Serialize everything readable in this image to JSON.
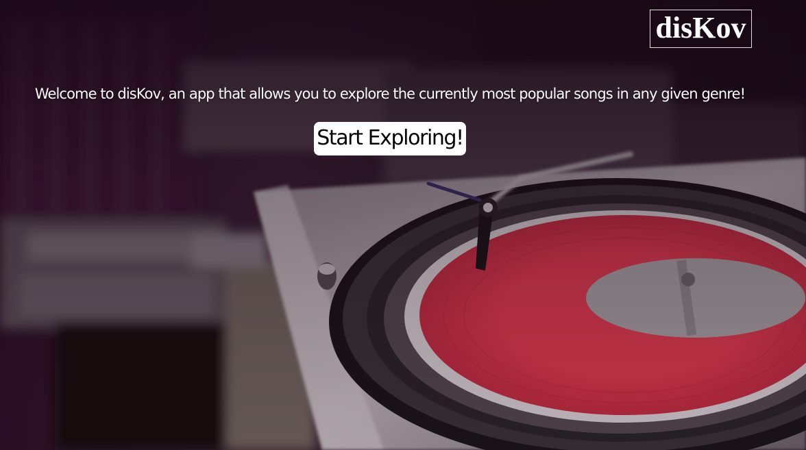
{
  "brand": {
    "logo_text": "disKov"
  },
  "hero": {
    "welcome_text": "Welcome to disKov, an app that allows you to explore the currently most popular songs in any given genre!",
    "cta_label": "Start Exploring!"
  },
  "background": {
    "description_icon": "turntable-background-image"
  },
  "colors": {
    "overlay": "#2a0f26",
    "record_red": "#e0364c",
    "label_gray": "#a9a3a6",
    "text": "#ffffff",
    "button_bg": "#ffffff"
  }
}
